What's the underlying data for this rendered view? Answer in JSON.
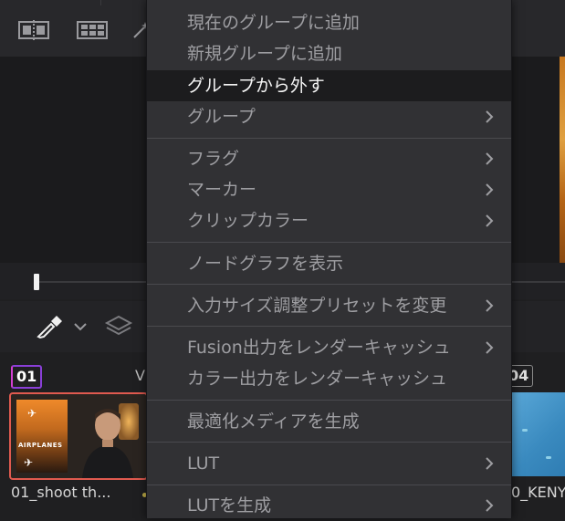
{
  "menu": {
    "items": [
      {
        "label": "現在のグループに追加",
        "submenu": false,
        "highlighted": false
      },
      {
        "label": "新規グループに追加",
        "submenu": false,
        "highlighted": false
      },
      {
        "label": "グループから外す",
        "submenu": false,
        "highlighted": true
      },
      {
        "label": "グループ",
        "submenu": true,
        "highlighted": false
      },
      {
        "label": "フラグ",
        "submenu": true,
        "highlighted": false
      },
      {
        "label": "マーカー",
        "submenu": true,
        "highlighted": false
      },
      {
        "label": "クリップカラー",
        "submenu": true,
        "highlighted": false
      },
      {
        "label": "ノードグラフを表示",
        "submenu": false,
        "highlighted": false
      },
      {
        "label": "入力サイズ調整プリセットを変更",
        "submenu": true,
        "highlighted": false
      },
      {
        "label": "Fusion出力をレンダーキャッシュ",
        "submenu": true,
        "highlighted": false
      },
      {
        "label": "カラー出力をレンダーキャッシュ",
        "submenu": false,
        "highlighted": false
      },
      {
        "label": "最適化メディアを生成",
        "submenu": false,
        "highlighted": false
      },
      {
        "label": "LUT",
        "submenu": true,
        "highlighted": false
      },
      {
        "label": "LUTを生成",
        "submenu": true,
        "highlighted": false
      }
    ]
  },
  "media_pool": {
    "clip1": {
      "number": "01",
      "name": "01_shoot th...",
      "poster_text": "AIRPLANES"
    },
    "clip2": {
      "number": "04",
      "name": "0_KENY"
    },
    "partial_label": "V"
  },
  "colors": {
    "menu_bg": "#313134",
    "highlight_bg": "#1c1c1e",
    "selected_border": "#e05a4f",
    "badge_purple": "#8a3fd8"
  }
}
